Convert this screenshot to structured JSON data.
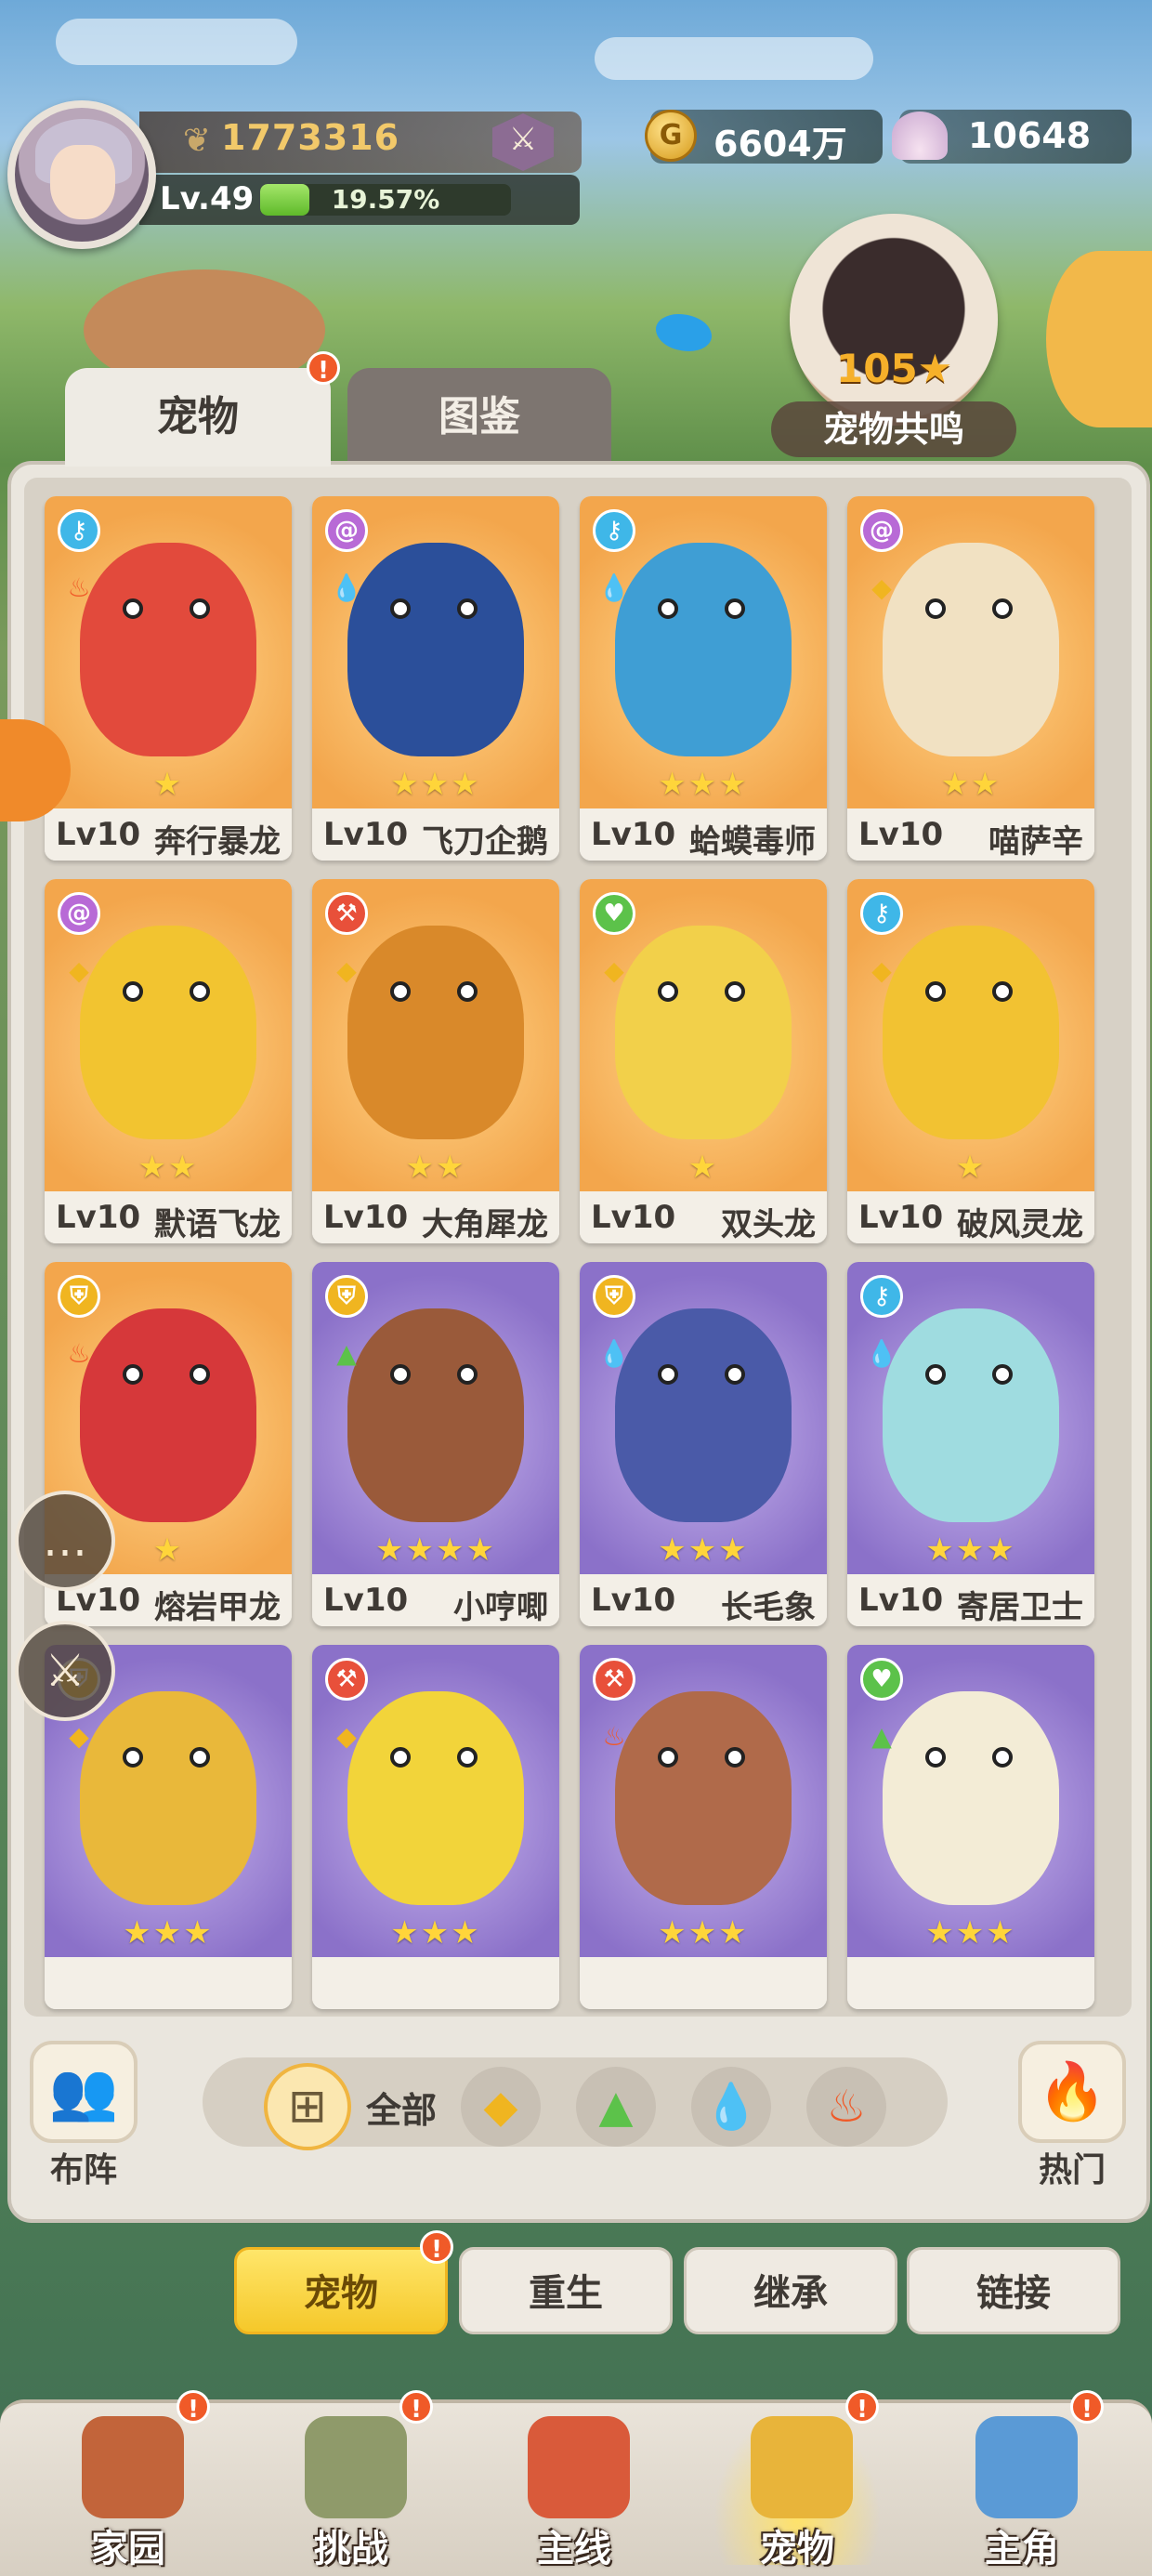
{
  "player": {
    "power": "1773316",
    "level": "Lv.49",
    "exp_percent_text": "19.57%",
    "exp_fraction": 0.1957
  },
  "currency": {
    "gold": "6604万",
    "shells": "10648"
  },
  "resonance": {
    "count": "105★",
    "label": "宠物共鸣"
  },
  "tabs": [
    {
      "label": "宠物",
      "active": true,
      "badge": "!"
    },
    {
      "label": "图鉴",
      "active": false
    }
  ],
  "pets": [
    {
      "level": "Lv10",
      "name": "奔行暴龙",
      "stars": "★",
      "bg": "orange",
      "type_color": "#3fb7e8",
      "type_icon": "key-icon",
      "elem_icon": "fire-icon",
      "elem_color": "#f05a28",
      "body": "#e24a3c"
    },
    {
      "level": "Lv10",
      "name": "飞刀企鹅",
      "stars": "★★★",
      "bg": "orange",
      "type_color": "#b86ad6",
      "type_icon": "swirl-icon",
      "elem_icon": "water-icon",
      "elem_color": "#2fb2e6",
      "body": "#2b4f9a"
    },
    {
      "level": "Lv10",
      "name": "蛤蟆毒师",
      "stars": "★★★",
      "bg": "orange",
      "type_color": "#3fb7e8",
      "type_icon": "key-icon",
      "elem_icon": "water-icon",
      "elem_color": "#2fb2e6",
      "body": "#3f9ed4"
    },
    {
      "level": "Lv10",
      "name": "喵萨辛",
      "stars": "★★",
      "bg": "orange",
      "type_color": "#b86ad6",
      "type_icon": "swirl-icon",
      "elem_icon": "earth-icon",
      "elem_color": "#f0b520",
      "body": "#f1e1c2"
    },
    {
      "level": "Lv10",
      "name": "默语飞龙",
      "stars": "★★",
      "bg": "orange",
      "type_color": "#b86ad6",
      "type_icon": "swirl-icon",
      "elem_icon": "earth-icon",
      "elem_color": "#f0b520",
      "body": "#f2c430"
    },
    {
      "level": "Lv10",
      "name": "大角犀龙",
      "stars": "★★",
      "bg": "orange",
      "type_color": "#e8503a",
      "type_icon": "axe-icon",
      "elem_icon": "earth-icon",
      "elem_color": "#f0b520",
      "body": "#d9892a"
    },
    {
      "level": "Lv10",
      "name": "双头龙",
      "stars": "★",
      "bg": "orange",
      "type_color": "#5cc24a",
      "type_icon": "heart-icon",
      "elem_icon": "earth-icon",
      "elem_color": "#f0b520",
      "body": "#f2d04a"
    },
    {
      "level": "Lv10",
      "name": "破风灵龙",
      "stars": "★",
      "bg": "orange",
      "type_color": "#3fb7e8",
      "type_icon": "key-icon",
      "elem_icon": "earth-icon",
      "elem_color": "#f0b520",
      "body": "#f2c232"
    },
    {
      "level": "Lv10",
      "name": "熔岩甲龙",
      "stars": "★",
      "bg": "orange",
      "type_color": "#f0b520",
      "type_icon": "shield-icon",
      "elem_icon": "fire-icon",
      "elem_color": "#f05a28",
      "body": "#d6383a"
    },
    {
      "level": "Lv10",
      "name": "小哼唧",
      "stars": "★★★★",
      "bg": "purple",
      "type_color": "#f0b520",
      "type_icon": "shield-icon",
      "elem_icon": "grass-icon",
      "elem_color": "#5cc24a",
      "body": "#9a5a3a"
    },
    {
      "level": "Lv10",
      "name": "长毛象",
      "stars": "★★★",
      "bg": "purple",
      "type_color": "#f0b520",
      "type_icon": "shield-icon",
      "elem_icon": "water-icon",
      "elem_color": "#2fb2e6",
      "body": "#4a5aa8"
    },
    {
      "level": "Lv10",
      "name": "寄居卫士",
      "stars": "★★★",
      "bg": "purple",
      "type_color": "#3fb7e8",
      "type_icon": "key-icon",
      "elem_icon": "water-icon",
      "elem_color": "#2fb2e6",
      "body": "#9fdce0"
    },
    {
      "level": "",
      "name": "",
      "stars": "★★★",
      "bg": "purple",
      "type_color": "#f0b520",
      "type_icon": "shield-icon",
      "elem_icon": "earth-icon",
      "elem_color": "#f0b520",
      "body": "#e9b83a"
    },
    {
      "level": "",
      "name": "",
      "stars": "★★★",
      "bg": "purple",
      "type_color": "#e8503a",
      "type_icon": "axe-icon",
      "elem_icon": "earth-icon",
      "elem_color": "#f0b520",
      "body": "#f2d43a"
    },
    {
      "level": "",
      "name": "",
      "stars": "★★★",
      "bg": "purple",
      "type_color": "#e8503a",
      "type_icon": "axe-icon",
      "elem_icon": "fire-icon",
      "elem_color": "#f05a28",
      "body": "#b06a4a"
    },
    {
      "level": "",
      "name": "",
      "stars": "★★★",
      "bg": "purple",
      "type_color": "#5cc24a",
      "type_icon": "heart-icon",
      "elem_icon": "grass-icon",
      "elem_color": "#5cc24a",
      "body": "#f3ecd6"
    }
  ],
  "filter": {
    "lineup_label": "布阵",
    "all_label": "全部",
    "hot_label": "热门",
    "elements": [
      {
        "icon": "earth-icon",
        "color": "#f0b520"
      },
      {
        "icon": "grass-icon",
        "color": "#5cc24a"
      },
      {
        "icon": "water-icon",
        "color": "#2fb2e6"
      },
      {
        "icon": "fire-icon",
        "color": "#f05a28"
      }
    ]
  },
  "sub_tabs": [
    {
      "label": "宠物",
      "active": true,
      "badge": "!"
    },
    {
      "label": "重生",
      "active": false
    },
    {
      "label": "继承",
      "active": false
    },
    {
      "label": "链接",
      "active": false
    }
  ],
  "nav": [
    {
      "label": "家园",
      "icon": "homestead-icon",
      "badge": "!",
      "active": false,
      "color": "#c2643a"
    },
    {
      "label": "挑战",
      "icon": "challenge-icon",
      "badge": "!",
      "active": false,
      "color": "#8f9a6a"
    },
    {
      "label": "主线",
      "icon": "main-quest-icon",
      "badge": "",
      "active": false,
      "color": "#d95a3a"
    },
    {
      "label": "宠物",
      "icon": "pet-icon",
      "badge": "!",
      "active": true,
      "color": "#e8b43a"
    },
    {
      "label": "主角",
      "icon": "hero-icon",
      "badge": "!",
      "active": false,
      "color": "#5a9ad6"
    }
  ]
}
